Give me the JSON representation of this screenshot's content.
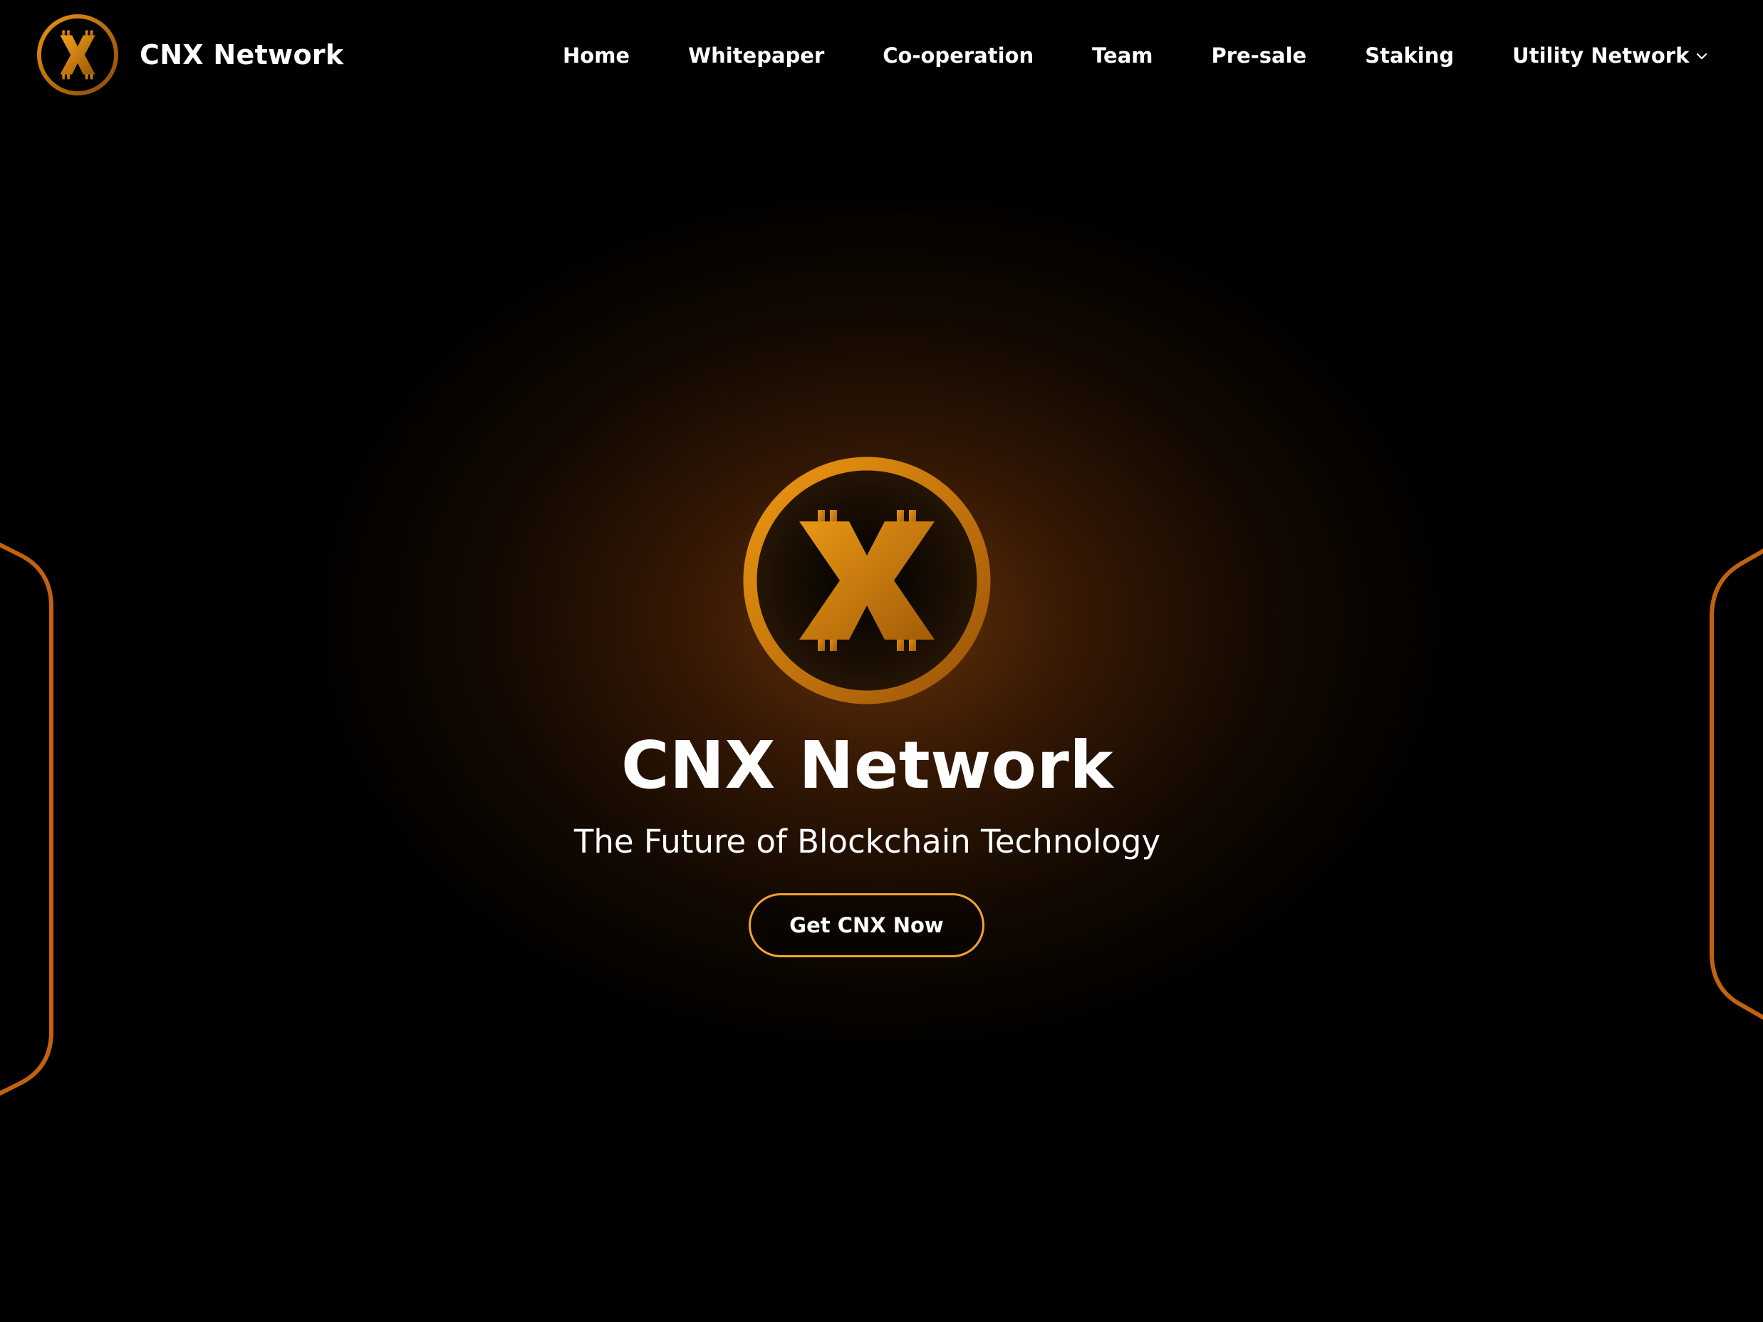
{
  "colors": {
    "accent": "#e08a12",
    "accent_dark": "#a85f0a",
    "button_border": "#f0a331",
    "background": "#000000",
    "text": "#ffffff"
  },
  "header": {
    "brand_name": "CNX Network",
    "logo_icon": "cnx-x-coin-icon",
    "nav": {
      "home": "Home",
      "whitepaper": "Whitepaper",
      "cooperation": "Co-operation",
      "team": "Team",
      "presale": "Pre-sale",
      "staking": "Staking",
      "utility_network": "Utility Network"
    },
    "dropdown_icon": "chevron-down-icon"
  },
  "hero": {
    "logo_icon": "cnx-x-coin-icon",
    "title": "CNX Network",
    "subtitle": "The Future of Blockchain Technology",
    "cta_label": "Get CNX Now"
  }
}
